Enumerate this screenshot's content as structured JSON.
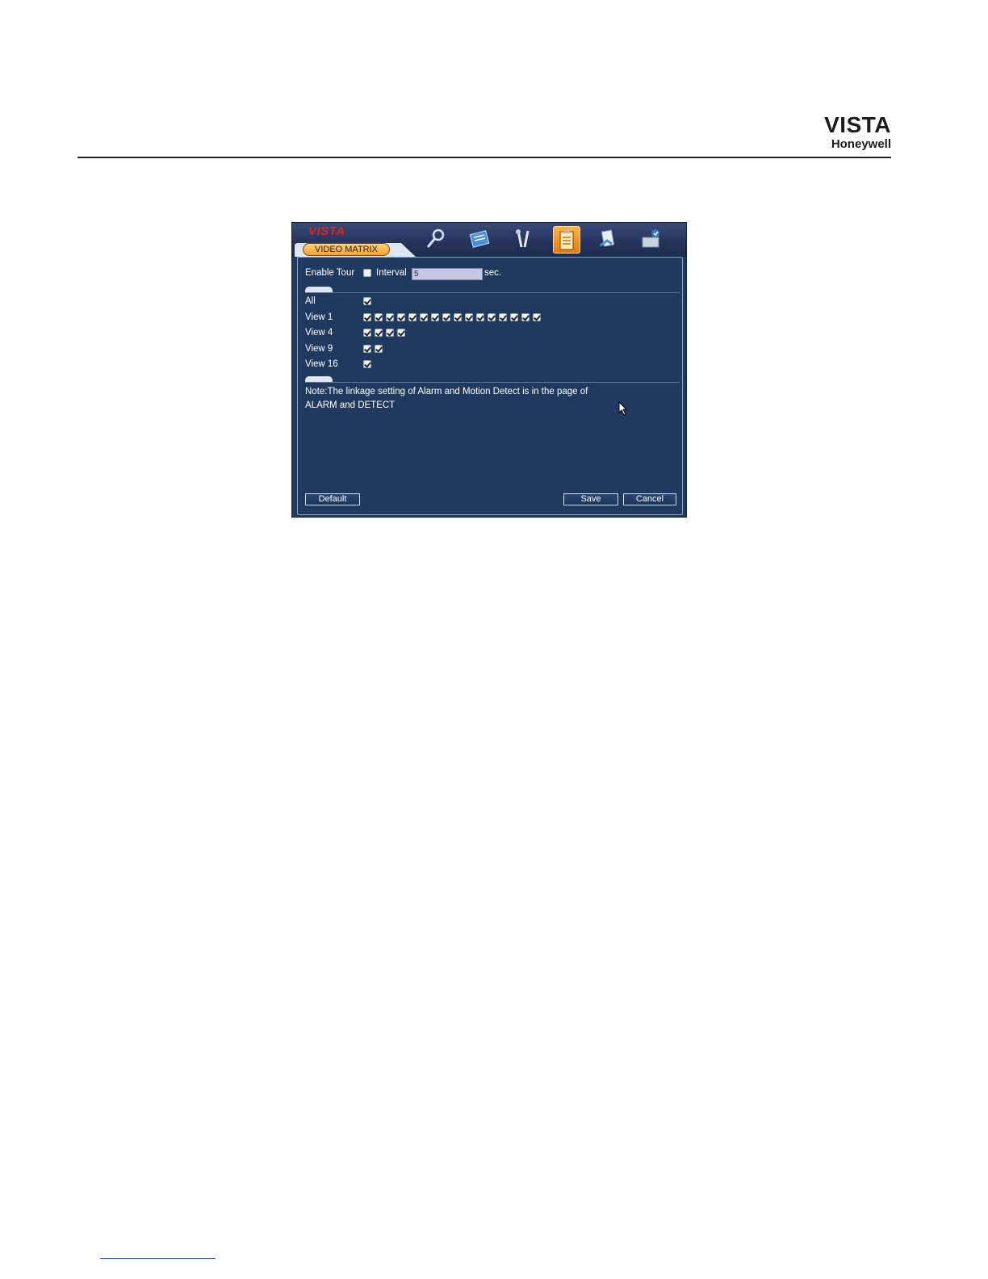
{
  "page": {
    "brand_vista": "VISTA",
    "brand_honeywell": "Honeywell"
  },
  "dvr": {
    "logo": "VISTA",
    "tab_title": "VIDEO MATRIX",
    "toolbar_icons": [
      "search-icon",
      "record-icon",
      "tools-icon",
      "settings-icon",
      "network-icon",
      "disk-icon"
    ],
    "active_toolbar_index": 3,
    "enable_tour_label": "Enable Tour",
    "enable_tour_checked": false,
    "interval_label": "Interval",
    "interval_value": "5",
    "interval_unit": "sec.",
    "rows": [
      {
        "label": "All",
        "count": 1
      },
      {
        "label": "View 1",
        "count": 16
      },
      {
        "label": "View 4",
        "count": 4
      },
      {
        "label": "View 9",
        "count": 2
      },
      {
        "label": "View 16",
        "count": 1
      }
    ],
    "note_line1": "Note:The linkage setting of Alarm and Motion Detect is in the page of",
    "note_line2": "ALARM and DETECT",
    "buttons": {
      "default": "Default",
      "save": "Save",
      "cancel": "Cancel"
    },
    "colors": {
      "panel_bg": "#1f3a5e",
      "logo_red": "#e2261b",
      "tab_orange": "#f4a22e"
    }
  }
}
